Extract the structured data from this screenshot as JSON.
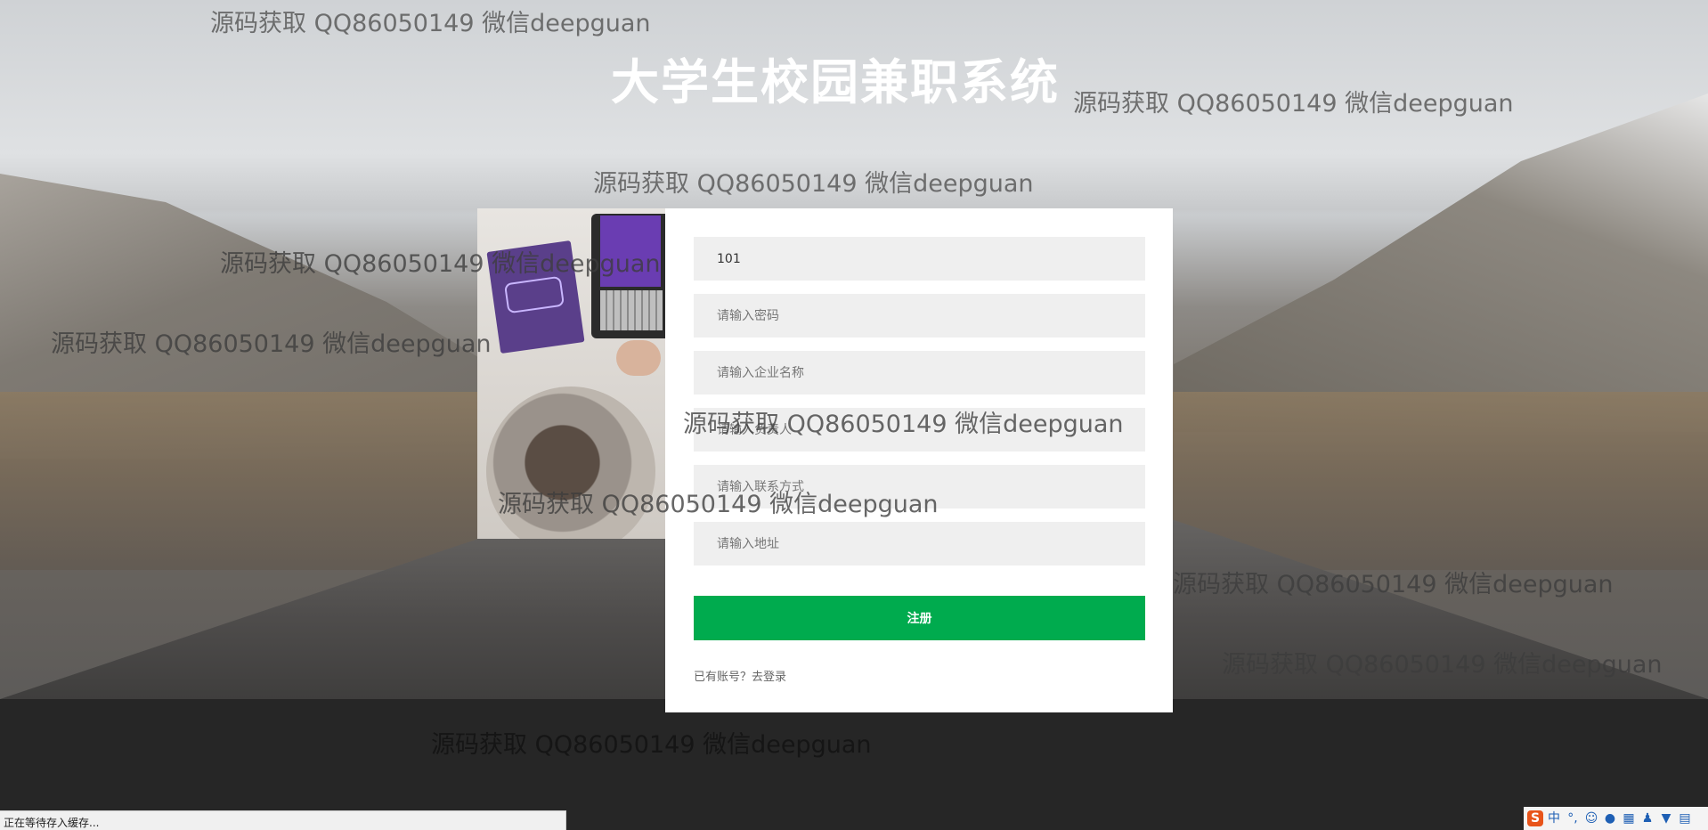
{
  "page": {
    "title": "大学生校园兼职系统"
  },
  "form": {
    "username_value": "101",
    "password_placeholder": "请输入密码",
    "company_placeholder": "请输入企业名称",
    "contact_person_placeholder": "请输入负责人",
    "phone_placeholder": "请输入联系方式",
    "address_placeholder": "请输入地址",
    "register_label": "注册",
    "login_link_text": "已有账号？去登录"
  },
  "watermark_text": "源码获取 QQ86050149 微信deepguan",
  "status_bar_text": "正在等待存入缓存...",
  "ime_tray": {
    "logo": "S",
    "mode": "中",
    "punctuation": "°,",
    "icons": [
      "emoji-icon",
      "microphone-icon",
      "keyboard-icon",
      "user-icon",
      "skin-icon",
      "toolbox-icon"
    ]
  },
  "colors": {
    "register_button": "#00ab4e",
    "card_background": "#ffffff",
    "field_background": "#efefef",
    "footer_background": "#262626"
  }
}
